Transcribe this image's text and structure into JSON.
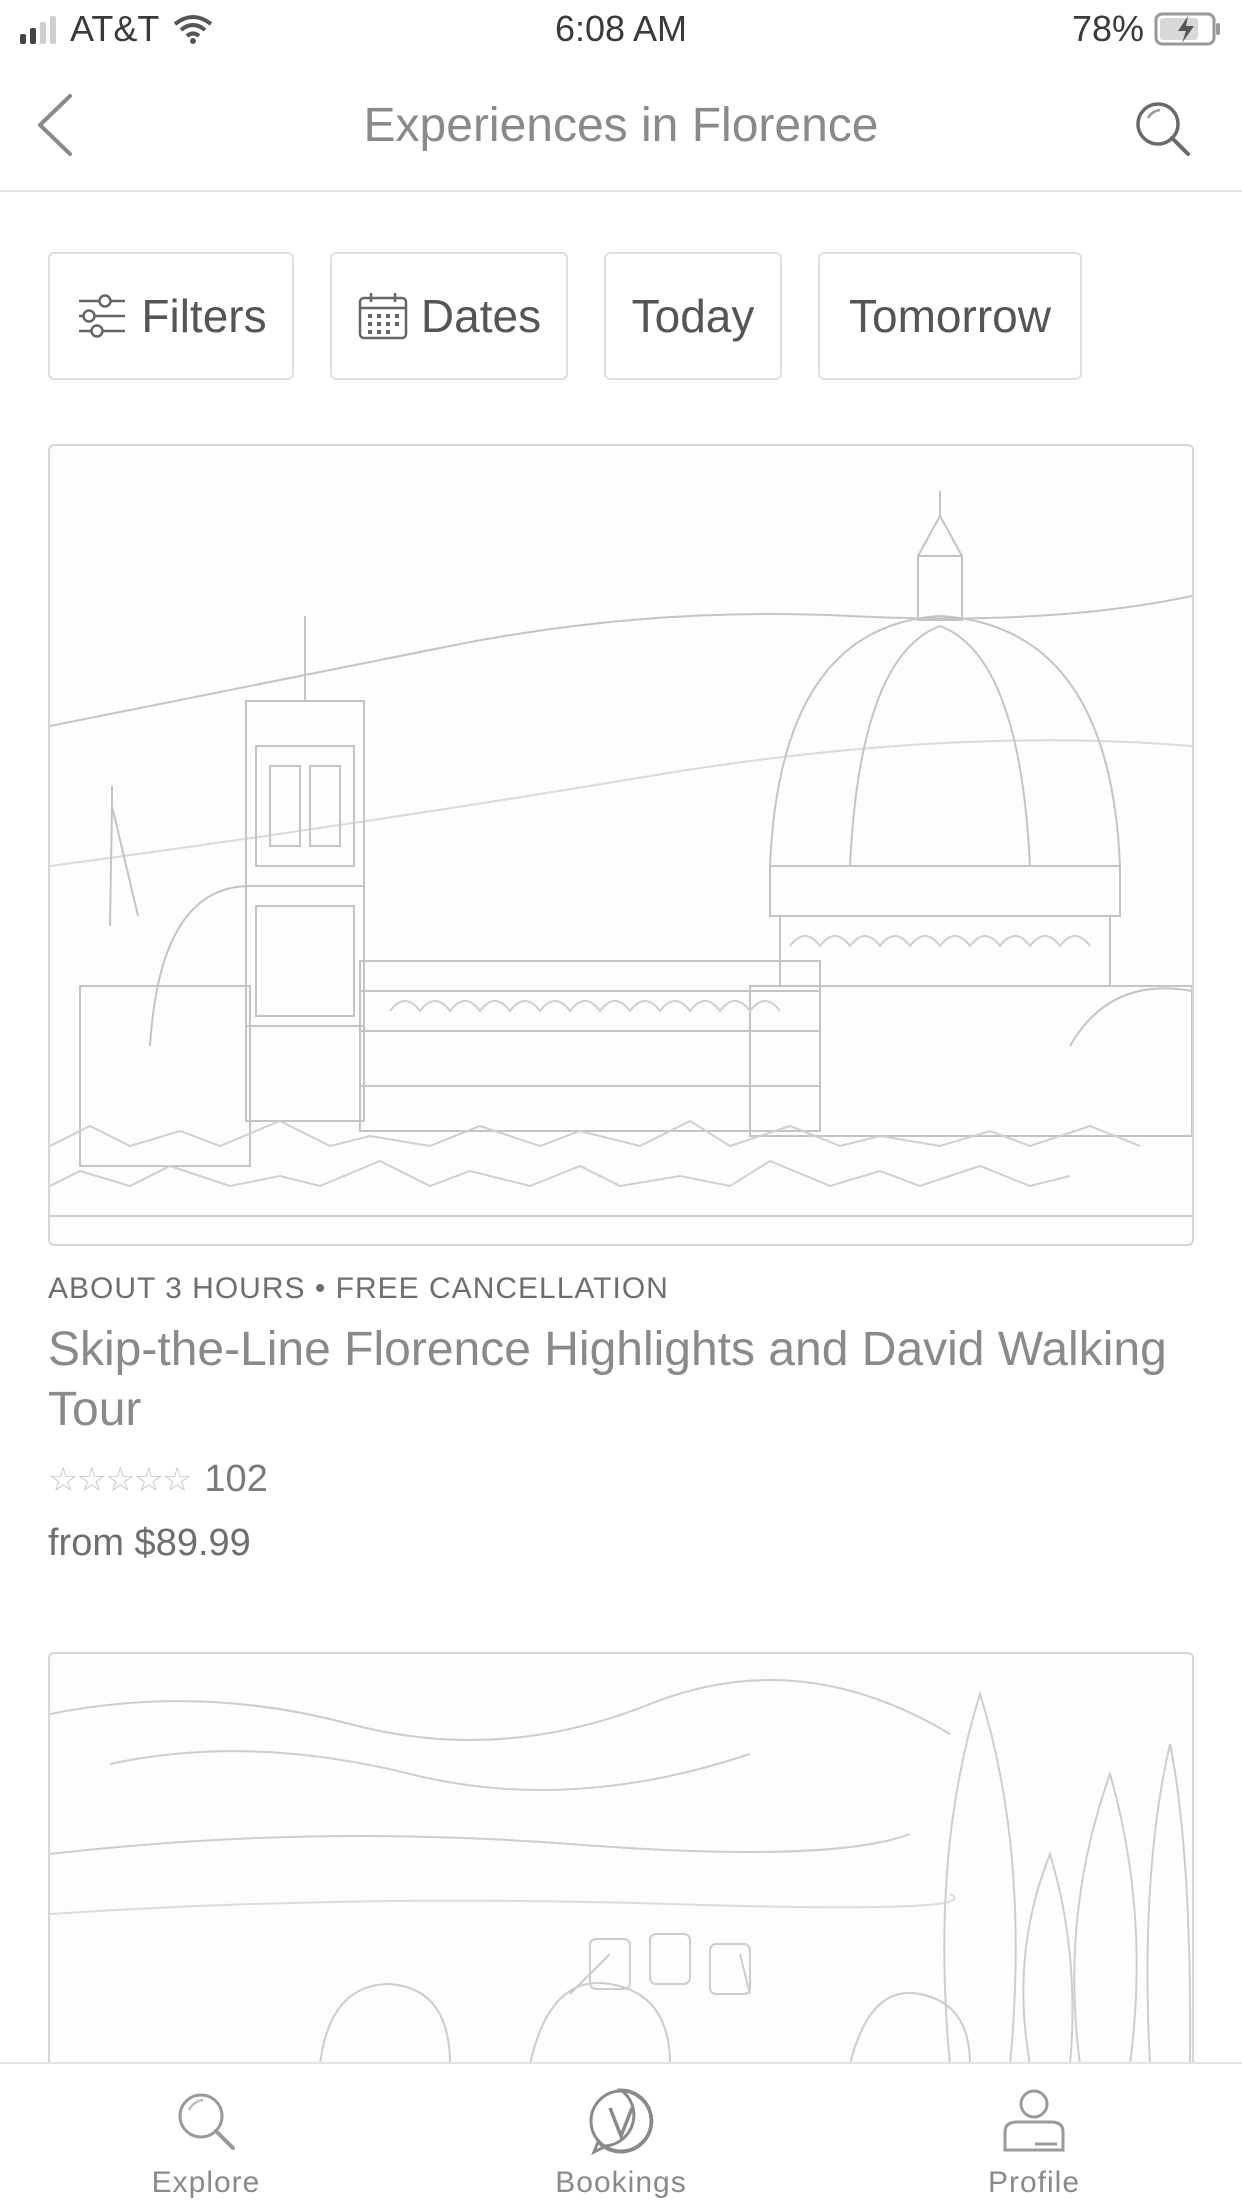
{
  "status_bar": {
    "carrier": "AT&T",
    "time": "6:08 AM",
    "battery": "78%"
  },
  "header": {
    "title": "Experiences in Florence",
    "back_icon": "chevron-left-icon",
    "search_icon": "search-icon"
  },
  "filters": {
    "filters_label": "Filters",
    "dates_label": "Dates",
    "today_label": "Today",
    "tomorrow_label": "Tomorrow"
  },
  "experiences": [
    {
      "meta": "ABOUT 3 HOURS • FREE CANCELLATION",
      "title": "Skip-the-Line Florence Highlights and David Walking Tour",
      "rating": 0,
      "review_count": "102",
      "price": "from $89.99"
    }
  ],
  "tab_bar": {
    "explore_label": "Explore",
    "bookings_label": "Bookings",
    "profile_label": "Profile"
  },
  "colors": {
    "text_muted": "#8a8a8a",
    "border": "#e0e0e0"
  }
}
